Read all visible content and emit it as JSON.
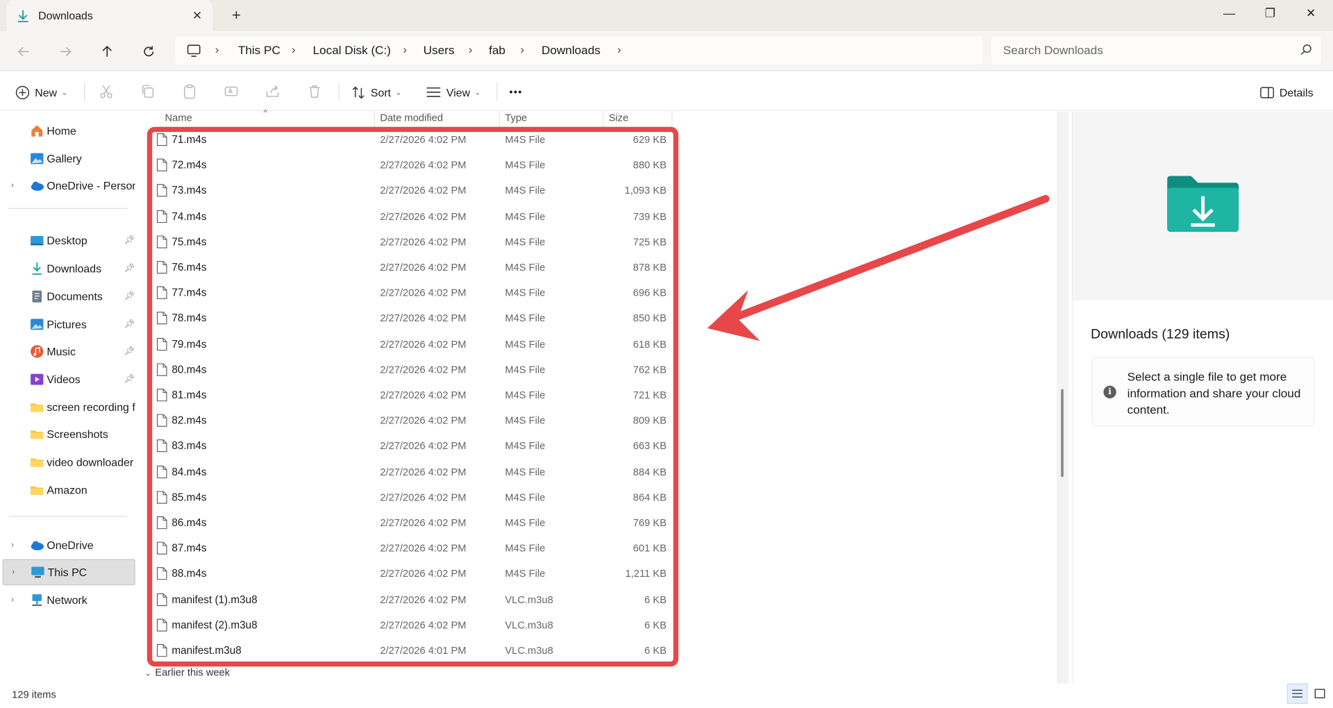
{
  "window": {
    "tab_title": "Downloads",
    "new_tab": "+",
    "close_tab": "✕",
    "minimize": "—",
    "maximize": "❐",
    "close": "✕"
  },
  "address": {
    "crumbs": [
      "This PC",
      "Local Disk (C:)",
      "Users",
      "fab",
      "Downloads"
    ],
    "search_placeholder": "Search Downloads"
  },
  "toolbar": {
    "new_label": "New",
    "sort_label": "Sort",
    "view_label": "View",
    "more_label": "•••",
    "details_label": "Details"
  },
  "sidebar": {
    "items": [
      {
        "label": "Home",
        "icon": "home-icon"
      },
      {
        "label": "Gallery",
        "icon": "gallery-icon"
      },
      {
        "label": "OneDrive - Persona",
        "icon": "onedrive-icon"
      },
      {
        "label": "Desktop",
        "icon": "desktop-icon"
      },
      {
        "label": "Downloads",
        "icon": "downloads-icon"
      },
      {
        "label": "Documents",
        "icon": "documents-icon"
      },
      {
        "label": "Pictures",
        "icon": "pictures-icon"
      },
      {
        "label": "Music",
        "icon": "music-icon"
      },
      {
        "label": "Videos",
        "icon": "videos-icon"
      },
      {
        "label": "screen recording fo",
        "icon": "folder-icon"
      },
      {
        "label": "Screenshots",
        "icon": "folder-icon"
      },
      {
        "label": "video downloader p",
        "icon": "folder-icon"
      },
      {
        "label": "Amazon",
        "icon": "folder-icon"
      },
      {
        "label": "OneDrive",
        "icon": "onedrive-icon"
      },
      {
        "label": "This PC",
        "icon": "this-pc-icon"
      },
      {
        "label": "Network",
        "icon": "network-icon"
      }
    ]
  },
  "columns": {
    "name": "Name",
    "date": "Date modified",
    "type": "Type",
    "size": "Size"
  },
  "files": [
    {
      "name": "71.m4s",
      "date": "2/27/2026 4:02 PM",
      "type": "M4S File",
      "size": "629 KB"
    },
    {
      "name": "72.m4s",
      "date": "2/27/2026 4:02 PM",
      "type": "M4S File",
      "size": "880 KB"
    },
    {
      "name": "73.m4s",
      "date": "2/27/2026 4:02 PM",
      "type": "M4S File",
      "size": "1,093 KB"
    },
    {
      "name": "74.m4s",
      "date": "2/27/2026 4:02 PM",
      "type": "M4S File",
      "size": "739 KB"
    },
    {
      "name": "75.m4s",
      "date": "2/27/2026 4:02 PM",
      "type": "M4S File",
      "size": "725 KB"
    },
    {
      "name": "76.m4s",
      "date": "2/27/2026 4:02 PM",
      "type": "M4S File",
      "size": "878 KB"
    },
    {
      "name": "77.m4s",
      "date": "2/27/2026 4:02 PM",
      "type": "M4S File",
      "size": "696 KB"
    },
    {
      "name": "78.m4s",
      "date": "2/27/2026 4:02 PM",
      "type": "M4S File",
      "size": "850 KB"
    },
    {
      "name": "79.m4s",
      "date": "2/27/2026 4:02 PM",
      "type": "M4S File",
      "size": "618 KB"
    },
    {
      "name": "80.m4s",
      "date": "2/27/2026 4:02 PM",
      "type": "M4S File",
      "size": "762 KB"
    },
    {
      "name": "81.m4s",
      "date": "2/27/2026 4:02 PM",
      "type": "M4S File",
      "size": "721 KB"
    },
    {
      "name": "82.m4s",
      "date": "2/27/2026 4:02 PM",
      "type": "M4S File",
      "size": "809 KB"
    },
    {
      "name": "83.m4s",
      "date": "2/27/2026 4:02 PM",
      "type": "M4S File",
      "size": "663 KB"
    },
    {
      "name": "84.m4s",
      "date": "2/27/2026 4:02 PM",
      "type": "M4S File",
      "size": "884 KB"
    },
    {
      "name": "85.m4s",
      "date": "2/27/2026 4:02 PM",
      "type": "M4S File",
      "size": "864 KB"
    },
    {
      "name": "86.m4s",
      "date": "2/27/2026 4:02 PM",
      "type": "M4S File",
      "size": "769 KB"
    },
    {
      "name": "87.m4s",
      "date": "2/27/2026 4:02 PM",
      "type": "M4S File",
      "size": "601 KB"
    },
    {
      "name": "88.m4s",
      "date": "2/27/2026 4:02 PM",
      "type": "M4S File",
      "size": "1,211 KB"
    },
    {
      "name": "manifest (1).m3u8",
      "date": "2/27/2026 4:02 PM",
      "type": "VLC.m3u8",
      "size": "6 KB"
    },
    {
      "name": "manifest (2).m3u8",
      "date": "2/27/2026 4:02 PM",
      "type": "VLC.m3u8",
      "size": "6 KB"
    },
    {
      "name": "manifest.m3u8",
      "date": "2/27/2026 4:01 PM",
      "type": "VLC.m3u8",
      "size": "6 KB"
    }
  ],
  "group_header": "Earlier this week",
  "details_pane": {
    "title": "Downloads (129 items)",
    "info": "Select a single file to get more information and share your cloud content."
  },
  "status": {
    "item_count": "129 items"
  },
  "colors": {
    "annotation": "#e8474a",
    "accent": "#0f9d8a",
    "folder": "#1aa89a"
  }
}
